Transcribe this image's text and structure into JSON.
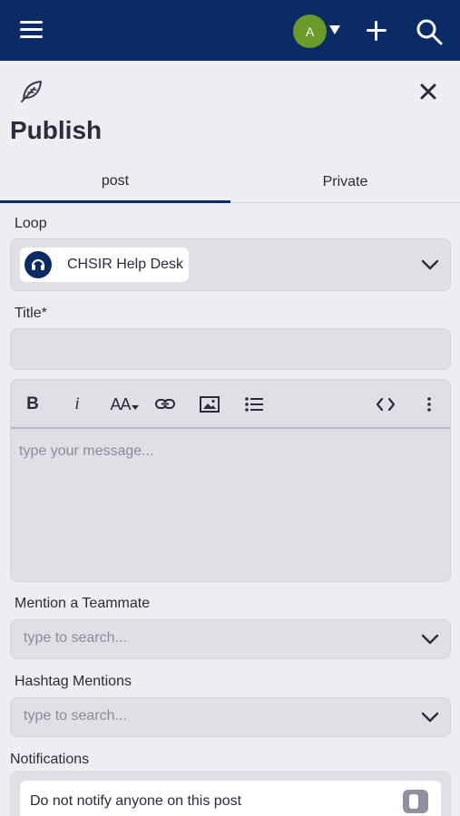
{
  "header": {
    "avatar_initial": "A",
    "icons": [
      "menu-icon",
      "avatar",
      "caret-down-icon",
      "plus-icon",
      "search-icon"
    ]
  },
  "panel": {
    "title": "Publish",
    "icons": [
      "leaf-icon",
      "close-icon"
    ]
  },
  "tabs": [
    {
      "label": "post",
      "active": true
    },
    {
      "label": "Private",
      "active": false
    }
  ],
  "form": {
    "loop_label": "Loop",
    "loop_value": "CHSIR Help Desk",
    "title_label": "Title*",
    "title_value": "",
    "editor_placeholder": "type your message...",
    "toolbar": [
      "bold-icon",
      "italic-icon",
      "font-size-icon",
      "link-icon",
      "image-icon",
      "bulleted-list-icon",
      "code-icon",
      "more-icon"
    ],
    "toolbar_text": {
      "bold": "B",
      "italic": "i",
      "font_size": "AA"
    },
    "mention_label": "Mention a Teammate",
    "mention_placeholder": "type to search...",
    "hashtag_label": "Hashtag Mentions",
    "hashtag_placeholder": "type to search...",
    "notifications_label": "Notifications",
    "notify_option": "Do not notify anyone on this post"
  },
  "colors": {
    "header_bg": "#0b2b66",
    "avatar_bg": "#6b9a2b",
    "field_bg": "#dfe0e6",
    "page_bg": "#eeeef2"
  }
}
